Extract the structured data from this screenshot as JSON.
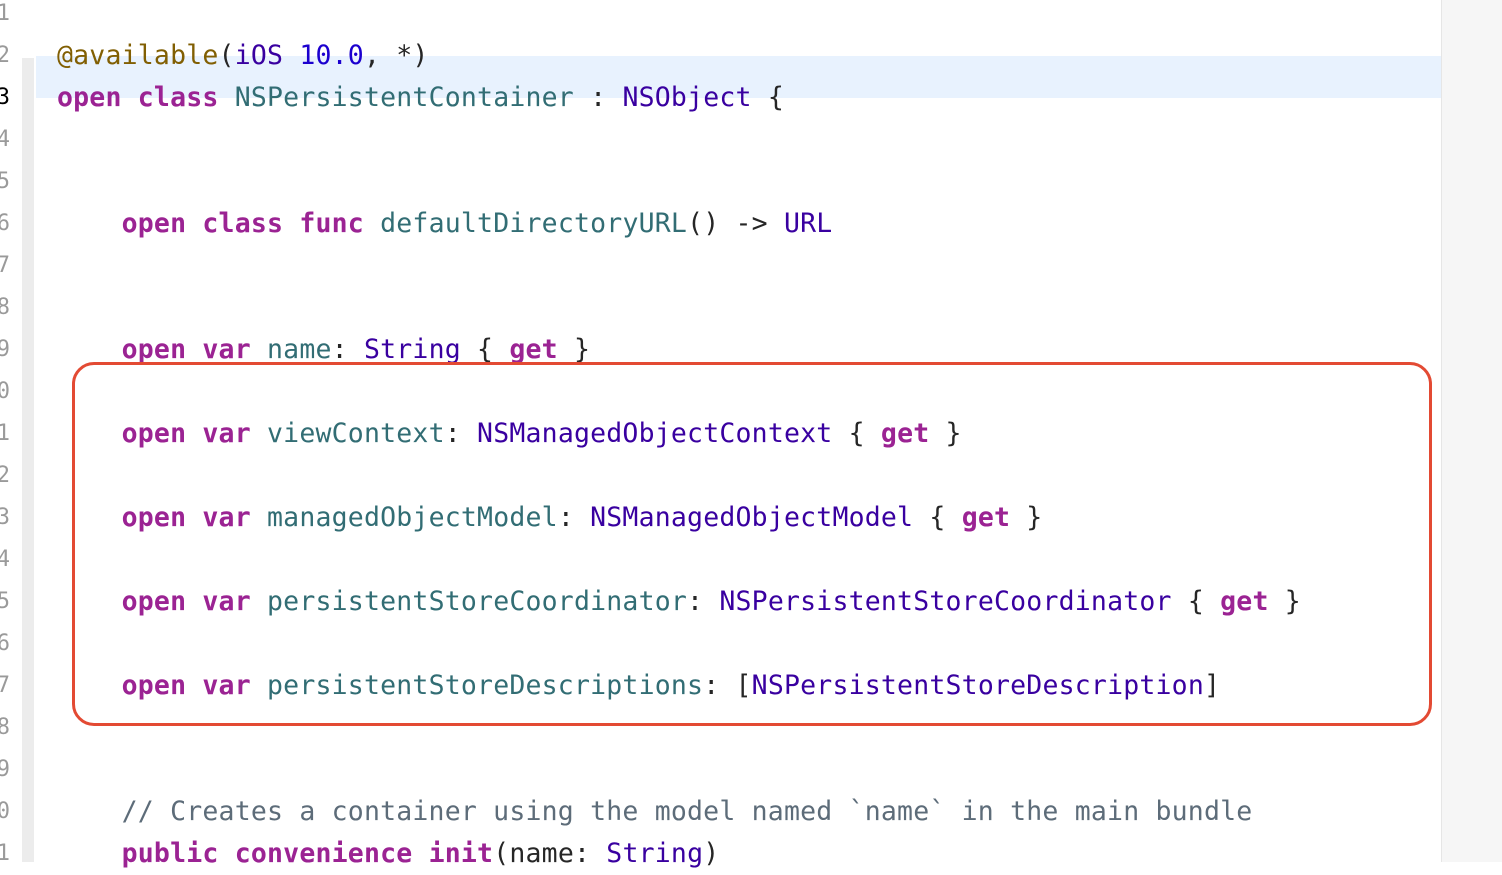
{
  "editor": {
    "highlight_color": "#e34a33",
    "gutter": {
      "line_numbers": [
        "1",
        "2",
        "3",
        "4",
        "5",
        "6",
        "7",
        "8",
        "9",
        "0",
        "1",
        "2",
        "3",
        "4",
        "5",
        "6",
        "7",
        "8",
        "9",
        "0",
        "1"
      ],
      "current_index": 2
    },
    "lines": [
      {
        "tokens": []
      },
      {
        "tokens": [
          {
            "t": "@available",
            "c": "attr"
          },
          {
            "t": "(",
            "c": "plain"
          },
          {
            "t": "iOS",
            "c": "typ"
          },
          {
            "t": " ",
            "c": "plain"
          },
          {
            "t": "10.0",
            "c": "num"
          },
          {
            "t": ", *)",
            "c": "plain"
          }
        ]
      },
      {
        "tokens": [
          {
            "t": "open",
            "c": "kw"
          },
          {
            "t": " ",
            "c": "plain"
          },
          {
            "t": "class",
            "c": "kw"
          },
          {
            "t": " ",
            "c": "plain"
          },
          {
            "t": "NSPersistentContainer",
            "c": "ident"
          },
          {
            "t": " : ",
            "c": "plain"
          },
          {
            "t": "NSObject",
            "c": "typ"
          },
          {
            "t": " {",
            "c": "plain"
          }
        ]
      },
      {
        "tokens": []
      },
      {
        "tokens": []
      },
      {
        "tokens": [
          {
            "t": "    ",
            "c": "plain"
          },
          {
            "t": "open",
            "c": "kw"
          },
          {
            "t": " ",
            "c": "plain"
          },
          {
            "t": "class",
            "c": "kw"
          },
          {
            "t": " ",
            "c": "plain"
          },
          {
            "t": "func",
            "c": "kw"
          },
          {
            "t": " ",
            "c": "plain"
          },
          {
            "t": "defaultDirectoryURL",
            "c": "ident"
          },
          {
            "t": "() -> ",
            "c": "plain"
          },
          {
            "t": "URL",
            "c": "typ"
          }
        ]
      },
      {
        "tokens": []
      },
      {
        "tokens": []
      },
      {
        "tokens": [
          {
            "t": "    ",
            "c": "plain"
          },
          {
            "t": "open",
            "c": "kw"
          },
          {
            "t": " ",
            "c": "plain"
          },
          {
            "t": "var",
            "c": "kw"
          },
          {
            "t": " ",
            "c": "plain"
          },
          {
            "t": "name",
            "c": "ident"
          },
          {
            "t": ": ",
            "c": "plain"
          },
          {
            "t": "String",
            "c": "typ"
          },
          {
            "t": " { ",
            "c": "plain"
          },
          {
            "t": "get",
            "c": "kw"
          },
          {
            "t": " }",
            "c": "plain"
          }
        ]
      },
      {
        "tokens": []
      },
      {
        "tokens": [
          {
            "t": "    ",
            "c": "plain"
          },
          {
            "t": "open",
            "c": "kw"
          },
          {
            "t": " ",
            "c": "plain"
          },
          {
            "t": "var",
            "c": "kw"
          },
          {
            "t": " ",
            "c": "plain"
          },
          {
            "t": "viewContext",
            "c": "ident"
          },
          {
            "t": ": ",
            "c": "plain"
          },
          {
            "t": "NSManagedObjectContext",
            "c": "typ"
          },
          {
            "t": " { ",
            "c": "plain"
          },
          {
            "t": "get",
            "c": "kw"
          },
          {
            "t": " }",
            "c": "plain"
          }
        ]
      },
      {
        "tokens": []
      },
      {
        "tokens": [
          {
            "t": "    ",
            "c": "plain"
          },
          {
            "t": "open",
            "c": "kw"
          },
          {
            "t": " ",
            "c": "plain"
          },
          {
            "t": "var",
            "c": "kw"
          },
          {
            "t": " ",
            "c": "plain"
          },
          {
            "t": "managedObjectModel",
            "c": "ident"
          },
          {
            "t": ": ",
            "c": "plain"
          },
          {
            "t": "NSManagedObjectModel",
            "c": "typ"
          },
          {
            "t": " { ",
            "c": "plain"
          },
          {
            "t": "get",
            "c": "kw"
          },
          {
            "t": " }",
            "c": "plain"
          }
        ]
      },
      {
        "tokens": []
      },
      {
        "tokens": [
          {
            "t": "    ",
            "c": "plain"
          },
          {
            "t": "open",
            "c": "kw"
          },
          {
            "t": " ",
            "c": "plain"
          },
          {
            "t": "var",
            "c": "kw"
          },
          {
            "t": " ",
            "c": "plain"
          },
          {
            "t": "persistentStoreCoordinator",
            "c": "ident"
          },
          {
            "t": ": ",
            "c": "plain"
          },
          {
            "t": "NSPersistentStoreCoordinator",
            "c": "typ"
          },
          {
            "t": " { ",
            "c": "plain"
          },
          {
            "t": "get",
            "c": "kw"
          },
          {
            "t": " }",
            "c": "plain"
          }
        ]
      },
      {
        "tokens": []
      },
      {
        "tokens": [
          {
            "t": "    ",
            "c": "plain"
          },
          {
            "t": "open",
            "c": "kw"
          },
          {
            "t": " ",
            "c": "plain"
          },
          {
            "t": "var",
            "c": "kw"
          },
          {
            "t": " ",
            "c": "plain"
          },
          {
            "t": "persistentStoreDescriptions",
            "c": "ident"
          },
          {
            "t": ": [",
            "c": "plain"
          },
          {
            "t": "NSPersistentStoreDescription",
            "c": "typ"
          },
          {
            "t": "]",
            "c": "plain"
          }
        ]
      },
      {
        "tokens": []
      },
      {
        "tokens": []
      },
      {
        "tokens": [
          {
            "t": "    ",
            "c": "plain"
          },
          {
            "t": "// Creates a container using the model named `name` in the main bundle",
            "c": "comment"
          }
        ]
      },
      {
        "tokens": [
          {
            "t": "    ",
            "c": "plain"
          },
          {
            "t": "public",
            "c": "kw"
          },
          {
            "t": " ",
            "c": "plain"
          },
          {
            "t": "convenience",
            "c": "kw"
          },
          {
            "t": " ",
            "c": "plain"
          },
          {
            "t": "init",
            "c": "kw"
          },
          {
            "t": "(name: ",
            "c": "plain"
          },
          {
            "t": "String",
            "c": "typ"
          },
          {
            "t": ")",
            "c": "plain"
          }
        ]
      }
    ]
  }
}
